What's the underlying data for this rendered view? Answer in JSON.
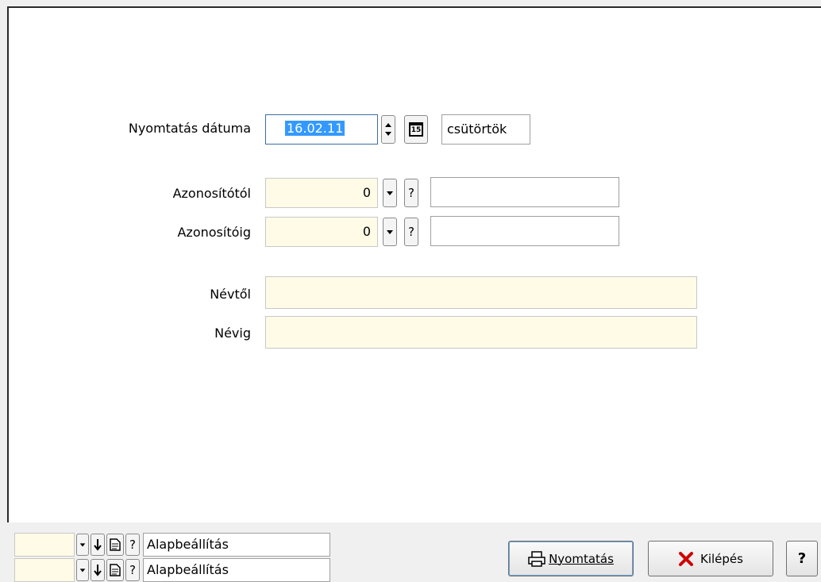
{
  "form": {
    "print_date_label": "Nyomtatás dátuma",
    "print_date_value": "16.02.11",
    "calendar_icon_text": "15",
    "weekday": "csütörtök",
    "id_from_label": "Azonosítótól",
    "id_from_value": "0",
    "id_to_label": "Azonosítóig",
    "id_to_value": "0",
    "name_from_label": "Névtől",
    "name_to_label": "Névig",
    "help_symbol": "?"
  },
  "footer": {
    "setting_rows": [
      {
        "label": "Alapbeállítás"
      },
      {
        "label": "Alapbeállítás"
      }
    ],
    "print_button": "Nyomtatás",
    "exit_button": "Kilépés",
    "help_button": "?"
  },
  "colors": {
    "highlight_field": "#fffbe6",
    "selection": "#3399ff",
    "exit_icon": "#d00000"
  }
}
